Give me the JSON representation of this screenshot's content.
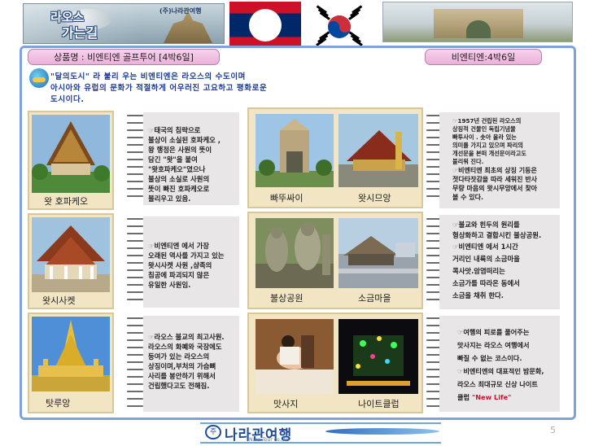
{
  "header": {
    "banner_title_a": "라오스",
    "banner_title_b": "가는길",
    "banner_brand": "(주)나라관여행"
  },
  "product": {
    "label": "상품명 : 비엔티엔 골프투어 [4박6일]",
    "duration": "비엔티엔:4박6일"
  },
  "intro": {
    "line1": "\"달의도시\" 라 불리 우는 비엔티엔은 라오스의 수도이며",
    "line2": "아시아와 유럽의 문화가 적절하게 어우러진 고요하고 평화로운",
    "line3": "도시이다."
  },
  "rows": [
    {
      "left_caption": "왓 호파케오",
      "left_text": [
        "태국의 침략으로",
        "불상이 소실된 호파케오 ,",
        "왕 행정은 사원의 뜻이",
        "담긴 \"왓\"을 붙여",
        "\"왓호파케오\"였으나",
        "불상의 소실로 사원의",
        "뜻이 빠진 호파케오로",
        "불리우고 있음."
      ],
      "photo_captions": [
        "빠뚜싸이",
        "왓시므앙"
      ],
      "right_text": [
        "1957년 건립된 라오스의",
        "상징적 건물인 독립기념물",
        "빠투사이 . 솟아 올라 있는",
        "의미를 가지고 있으며 파리의",
        "개선문을 본떠 개선문이라고도",
        "불리워 진다.",
        "",
        "비엔티엔 최초의 상징 기둥은",
        "젓다타잣감을 따라 세워진 반사",
        "무량 마음의 왓시무앙에서 찾아",
        "볼 수 있다."
      ]
    },
    {
      "left_caption": "왓시사켓",
      "left_text": [
        "비엔티엔 에서 가장",
        "오래된 역사를 가지고 있는",
        "왓시사켓 사원 ,샴족의",
        "침공에 파괴되지 않은",
        "유일한 사원임."
      ],
      "photo_captions": [
        "불상공원",
        "소금마을"
      ],
      "right_text": [
        "불교와 힌두의 원리를",
        "형상화하고 결합시킨 불상공원.",
        "",
        "비엔티엔 에서 1시간",
        "거리인 내륙의 소금마을",
        "콕사앗.암염떠리는",
        "소금가를 따라온 동에서",
        "소금을 채취 한다."
      ]
    },
    {
      "left_caption": "탓루앙",
      "left_text": [
        "라오스 불교의 최고사원.",
        "라오스의 화폐와 국장에도",
        "등여가 있는 라오스의",
        "상징이며,부처의 가슴뼈",
        "사리를 봉안하기 위해서",
        "건립했다고도 전해짐."
      ],
      "photo_captions": [
        "맛사지",
        "나이트클럽"
      ],
      "right_text": [
        "여행의 피로를 풀어주는",
        "맛사지는 라오스 여행에서",
        "빠질 수 없는 코스이다.",
        "",
        "비엔티엔의 대표적인 밤문화,",
        "라오스 최대규모 신상 나이트",
        "클럽"
      ],
      "right_highlight": "\"New Life\""
    }
  ],
  "footer": {
    "mark": "주",
    "brand": "나라관여행",
    "sub": "Nara Tour co.,ltd",
    "page_number": "5"
  },
  "colors": {
    "frame_border": "#7ea3d6",
    "label_fill": "#eab1da",
    "intro_text": "#1e3b96",
    "textbox_fill": "#e9e6e8",
    "highlight_red": "#d0112b"
  }
}
